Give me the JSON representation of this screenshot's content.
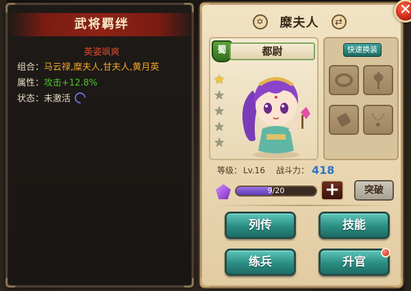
{
  "left_panel": {
    "title": "武将羁绊",
    "bond_name": "英姿飒爽",
    "combo_label": "组合：",
    "combo_value": "马云禄,糜夫人,甘夫人,黄月英",
    "attr_label": "属性：",
    "attr_value": "攻击+12.8%",
    "status_label": "状态：",
    "status_value": "未激活",
    "status_icon": "swirl-icon"
  },
  "character": {
    "name": "糜夫人",
    "faction": "蜀",
    "rank": "都尉",
    "stars_total": 5,
    "stars_on": 1,
    "level_label": "等级：",
    "level_value": "Lv.16",
    "power_label": "战斗力：",
    "power_value": "418",
    "exp_current": 9,
    "exp_max": 20,
    "exp_text": "9/20"
  },
  "equipment": {
    "quick_equip_label": "快速换装",
    "slots": [
      "ring-icon",
      "axe-icon",
      "scroll-icon",
      "necklace-icon"
    ]
  },
  "actions": {
    "plus_label": "+",
    "breakthrough_label": "突破",
    "biography_label": "列传",
    "skills_label": "技能",
    "train_label": "练兵",
    "promote_label": "升官"
  },
  "header_icons": {
    "left": "hexagram-icon",
    "right": "swap-icon",
    "close": "close-icon"
  },
  "colors": {
    "title_red": "#8d2316",
    "bond_name": "#e34a2d",
    "combo": "#f3a92d",
    "attr": "#4ec12c",
    "power": "#2f74c5",
    "button_teal": "#2a8d83",
    "exp_purple": "#7b52d0"
  }
}
